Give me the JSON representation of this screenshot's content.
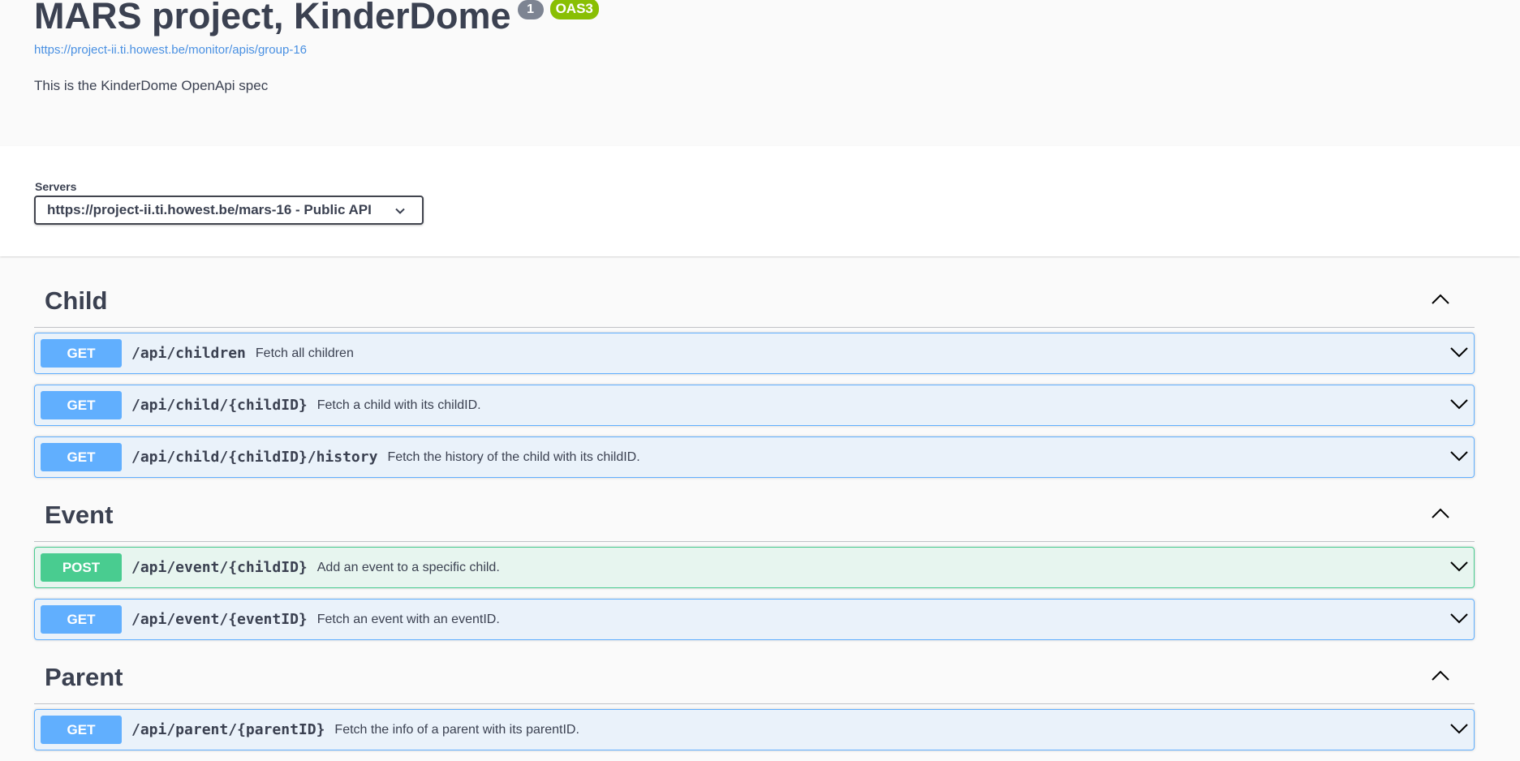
{
  "info": {
    "title": "MARS project, KinderDome",
    "version": "1",
    "oas_badge": "OAS3",
    "url": "https://project-ii.ti.howest.be/monitor/apis/group-16",
    "description": "This is the KinderDome OpenApi spec"
  },
  "servers": {
    "label": "Servers",
    "selected": "https://project-ii.ti.howest.be/mars-16 - Public API"
  },
  "tags": [
    {
      "name": "Child",
      "operations": [
        {
          "method": "GET",
          "path": "/api/children",
          "summary": "Fetch all children"
        },
        {
          "method": "GET",
          "path": "/api/child/{childID}",
          "summary": "Fetch a child with its childID."
        },
        {
          "method": "GET",
          "path": "/api/child/{childID}/history",
          "summary": "Fetch the history of the child with its childID."
        }
      ]
    },
    {
      "name": "Event",
      "operations": [
        {
          "method": "POST",
          "path": "/api/event/{childID}",
          "summary": "Add an event to a specific child."
        },
        {
          "method": "GET",
          "path": "/api/event/{eventID}",
          "summary": "Fetch an event with an eventID."
        }
      ]
    },
    {
      "name": "Parent",
      "operations": [
        {
          "method": "GET",
          "path": "/api/parent/{parentID}",
          "summary": "Fetch the info of a parent with its parentID."
        }
      ]
    }
  ],
  "colors": {
    "get": "#61affe",
    "post": "#49cc90",
    "oas_badge": "#89bf04",
    "version_badge": "#7d8492",
    "link": "#4990e2"
  },
  "icons": {
    "tag_toggle": "chevron-up-icon",
    "op_toggle": "chevron-down-icon",
    "server_select": "chevron-down-icon"
  }
}
